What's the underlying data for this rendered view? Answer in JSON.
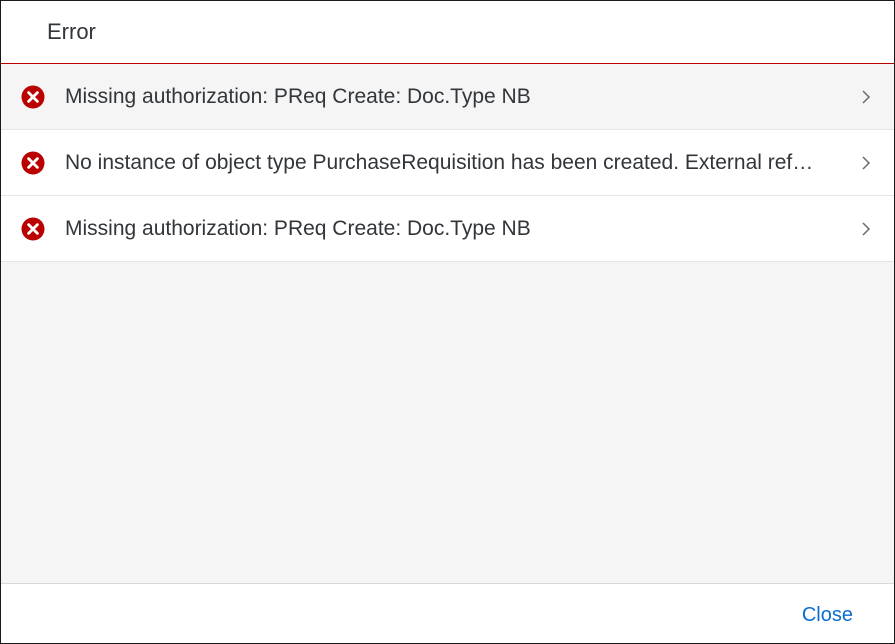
{
  "dialog": {
    "title": "Error",
    "messages": [
      {
        "text": "Missing authorization: PReq Create: Doc.Type NB",
        "icon": "error-circle-icon"
      },
      {
        "text": "No instance of object type PurchaseRequisition has been created. External reference:",
        "icon": "error-circle-icon"
      },
      {
        "text": "Missing authorization: PReq Create: Doc.Type NB",
        "icon": "error-circle-icon"
      }
    ],
    "close_label": "Close"
  },
  "colors": {
    "error": "#bb0000",
    "link": "#0a6ed1",
    "text": "#32363a"
  }
}
